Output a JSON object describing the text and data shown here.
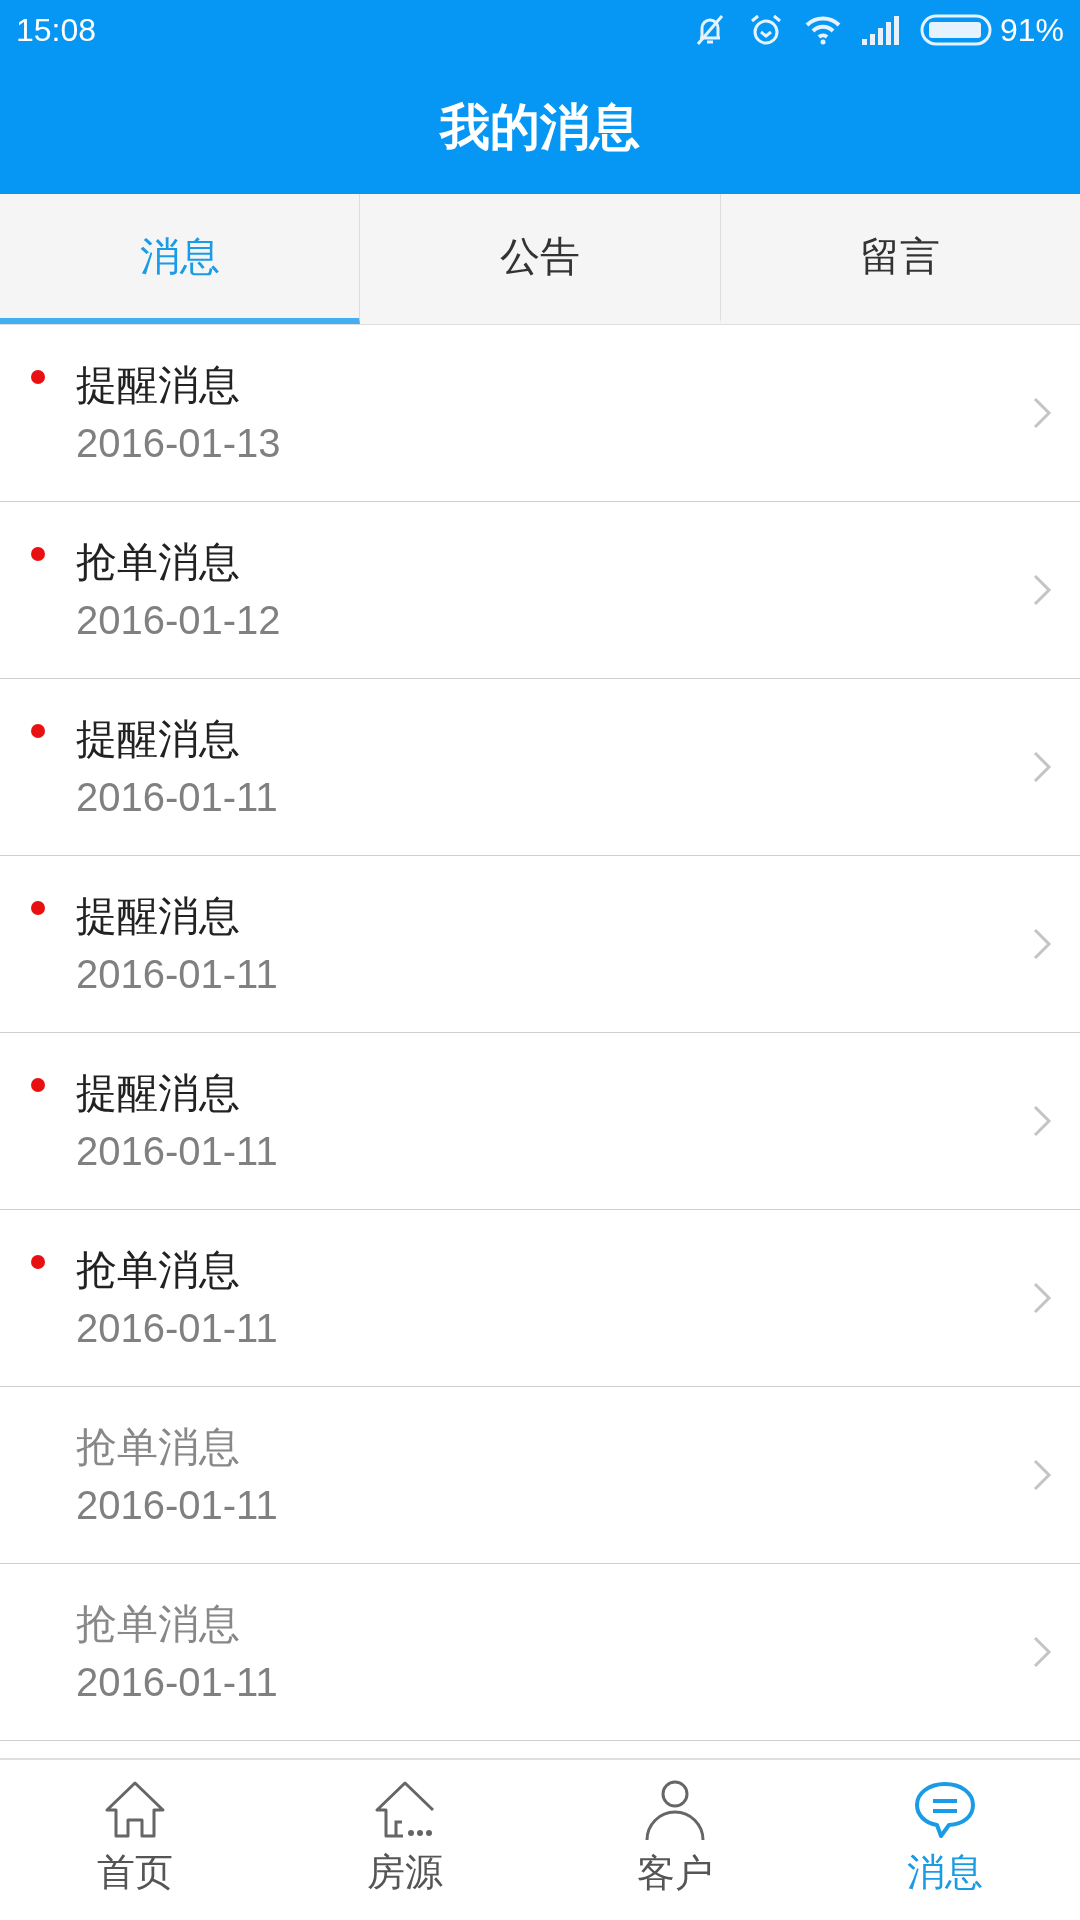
{
  "status_bar": {
    "time": "15:08",
    "battery": "91%"
  },
  "header": {
    "title": "我的消息"
  },
  "tabs": [
    {
      "label": "消息",
      "selected": true
    },
    {
      "label": "公告",
      "selected": false
    },
    {
      "label": "留言",
      "selected": false
    }
  ],
  "messages": [
    {
      "title": "提醒消息",
      "date": "2016-01-13",
      "unread": true
    },
    {
      "title": "抢单消息",
      "date": "2016-01-12",
      "unread": true
    },
    {
      "title": "提醒消息",
      "date": "2016-01-11",
      "unread": true
    },
    {
      "title": "提醒消息",
      "date": "2016-01-11",
      "unread": true
    },
    {
      "title": "提醒消息",
      "date": "2016-01-11",
      "unread": true
    },
    {
      "title": "抢单消息",
      "date": "2016-01-11",
      "unread": true
    },
    {
      "title": "抢单消息",
      "date": "2016-01-11",
      "unread": false
    },
    {
      "title": "抢单消息",
      "date": "2016-01-11",
      "unread": false
    }
  ],
  "bottom_nav": [
    {
      "label": "首页",
      "kind": "home",
      "selected": false
    },
    {
      "label": "房源",
      "kind": "listings",
      "selected": false
    },
    {
      "label": "客户",
      "kind": "person",
      "selected": false
    },
    {
      "label": "消息",
      "kind": "chat",
      "selected": true
    }
  ]
}
